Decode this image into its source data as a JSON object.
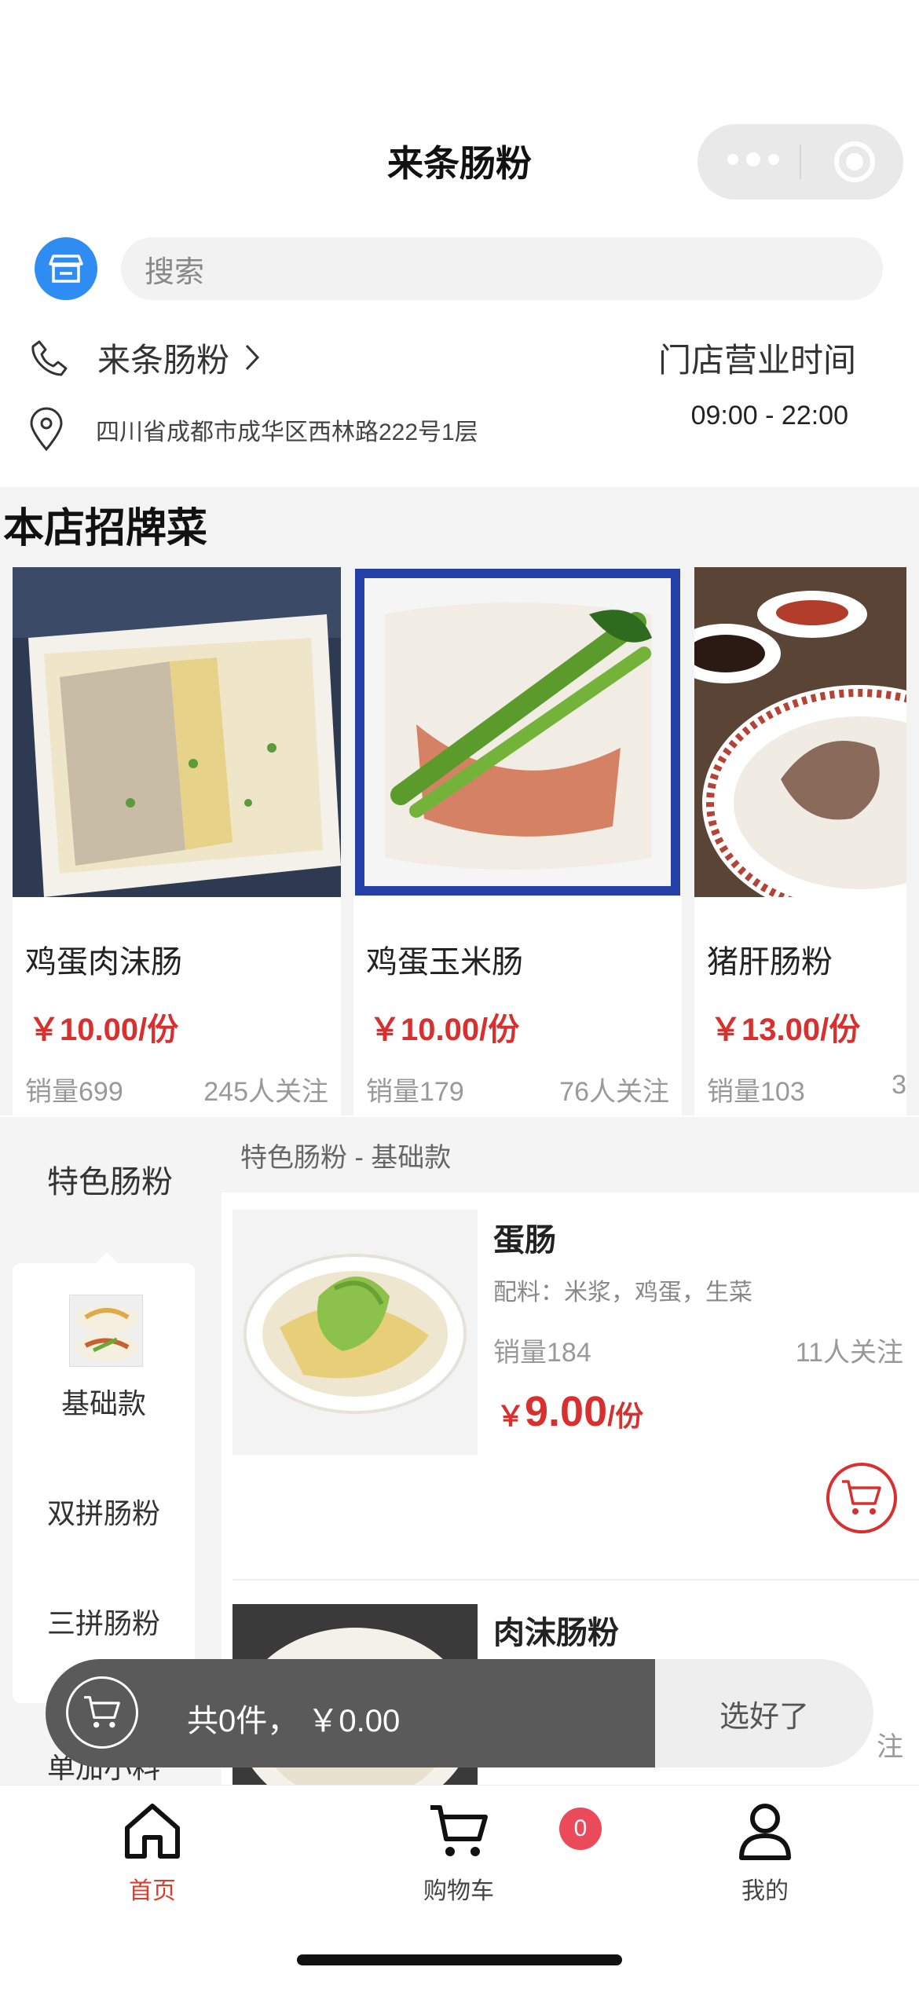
{
  "navbar": {
    "title": "来条肠粉"
  },
  "search": {
    "placeholder": "搜索"
  },
  "shop": {
    "name": "来条肠粉",
    "address": "四川省成都市成华区西林路222号1层",
    "hours_label": "门店营业时间",
    "hours": "09:00 - 22:00"
  },
  "signature": {
    "title": "本店招牌菜",
    "items": [
      {
        "name": "鸡蛋肉沫肠",
        "price": "￥10.00/份",
        "sales": "销量699",
        "followers": "245人关注"
      },
      {
        "name": "鸡蛋玉米肠",
        "price": "￥10.00/份",
        "sales": "销量179",
        "followers": "76人关注"
      },
      {
        "name": "猪肝肠粉",
        "price": "￥13.00/份",
        "sales": "销量103",
        "followers": "3"
      }
    ]
  },
  "categories": {
    "current": "特色肠粉",
    "subcategories": [
      "基础款",
      "双拼肠粉",
      "三拼肠粉",
      "单加小料"
    ]
  },
  "product_list": {
    "header": "特色肠粉 - 基础款",
    "items": [
      {
        "name": "蛋肠",
        "ingredients": "配料：米浆，鸡蛋，生菜",
        "sales": "销量184",
        "followers": "11人关注",
        "currency": "￥",
        "price": "9.00",
        "unit": "/份"
      },
      {
        "name": "肉沫肠粉",
        "followers_partial": "注"
      }
    ]
  },
  "cart": {
    "summary": "共0件，  ￥0.00",
    "checkout_label": "选好了",
    "badge_count": "0"
  },
  "tabbar": {
    "items": [
      {
        "label": "首页",
        "icon": "home-icon"
      },
      {
        "label": "购物车",
        "icon": "cart-icon"
      },
      {
        "label": "我的",
        "icon": "user-icon"
      }
    ]
  },
  "colors": {
    "accent": "#d8302f",
    "active_tab": "#e03c2c",
    "shop_icon": "#2f8cf2",
    "badge": "#ea4a5a"
  }
}
